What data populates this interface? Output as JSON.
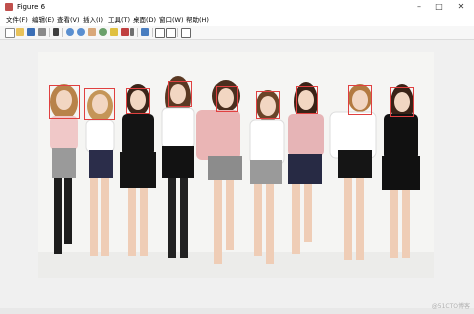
{
  "window": {
    "title": "Figure 6"
  },
  "menu": [
    "文件(F)",
    "编辑(E)",
    "查看(V)",
    "插入(I)",
    "工具(T)",
    "桌面(D)",
    "窗口(W)",
    "帮助(H)"
  ],
  "toolbar": {
    "icons": [
      "new-figure-icon",
      "open-file-icon",
      "save-icon",
      "print-icon",
      "edit-plot-icon",
      "zoom-in-icon",
      "zoom-out-icon",
      "pan-icon",
      "rotate-3d-icon",
      "data-cursor-icon",
      "brush-icon",
      "link-plot-icon",
      "insert-colorbar-icon",
      "insert-legend-icon",
      "hide-plot-tools-icon",
      "show-plot-tools-icon"
    ]
  },
  "figure": {
    "face_count": 9,
    "box_color": "#e04040"
  },
  "watermark": "@51CTO博客"
}
